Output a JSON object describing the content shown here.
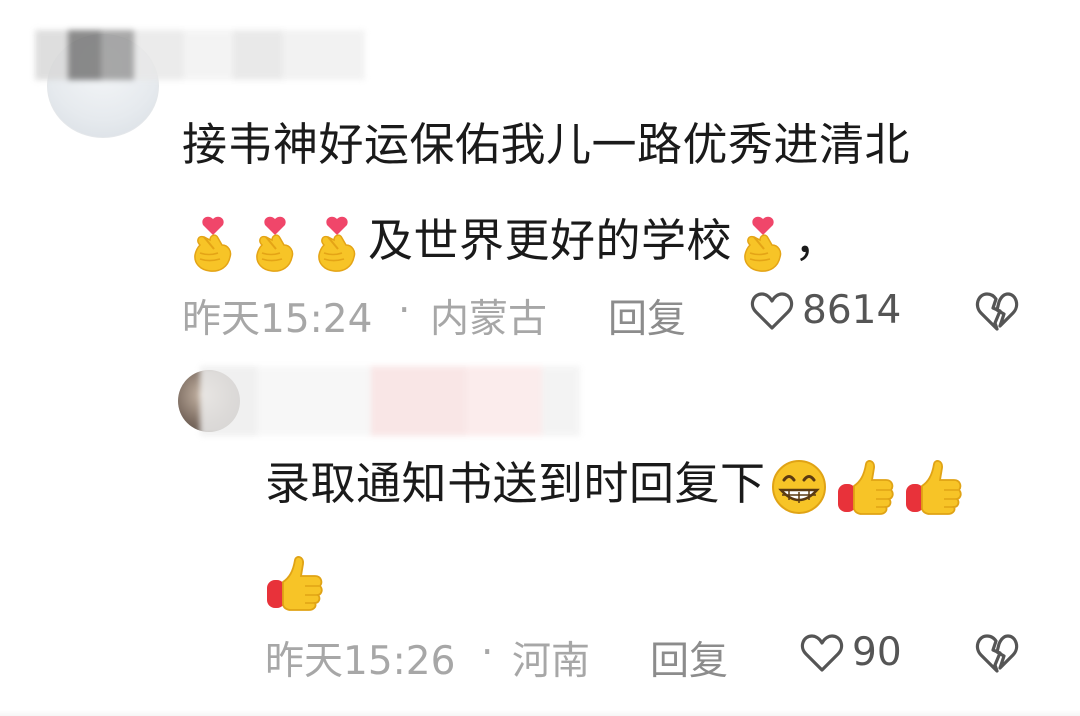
{
  "comments": [
    {
      "text_lines": [
        "接韦神好运保佑我儿一路优秀进清北",
        "及世界更好的学校"
      ],
      "trailing_punct": "，",
      "time": "昨天15:24",
      "sep": "·",
      "location": "内蒙古",
      "reply_label": "回复",
      "likes": "8614"
    },
    {
      "text_lines": [
        "录取通知书送到时回复下"
      ],
      "time": "昨天15:26",
      "sep": "·",
      "location": "河南",
      "reply_label": "回复",
      "likes": "90"
    }
  ],
  "icons": {
    "finger_heart": "finger-heart-emoji",
    "grin": "grinning-face-emoji",
    "thumbs_up": "thumbs-up-emoji",
    "like": "heart-outline-icon",
    "dislike": "broken-heart-icon"
  },
  "colors": {
    "text": "#1a1a1a",
    "meta": "#a7a7a7",
    "reply": "#8c8c8c",
    "like_count": "#555555",
    "emoji_yellow": "#f7c427",
    "emoji_heart": "#f0466a"
  }
}
